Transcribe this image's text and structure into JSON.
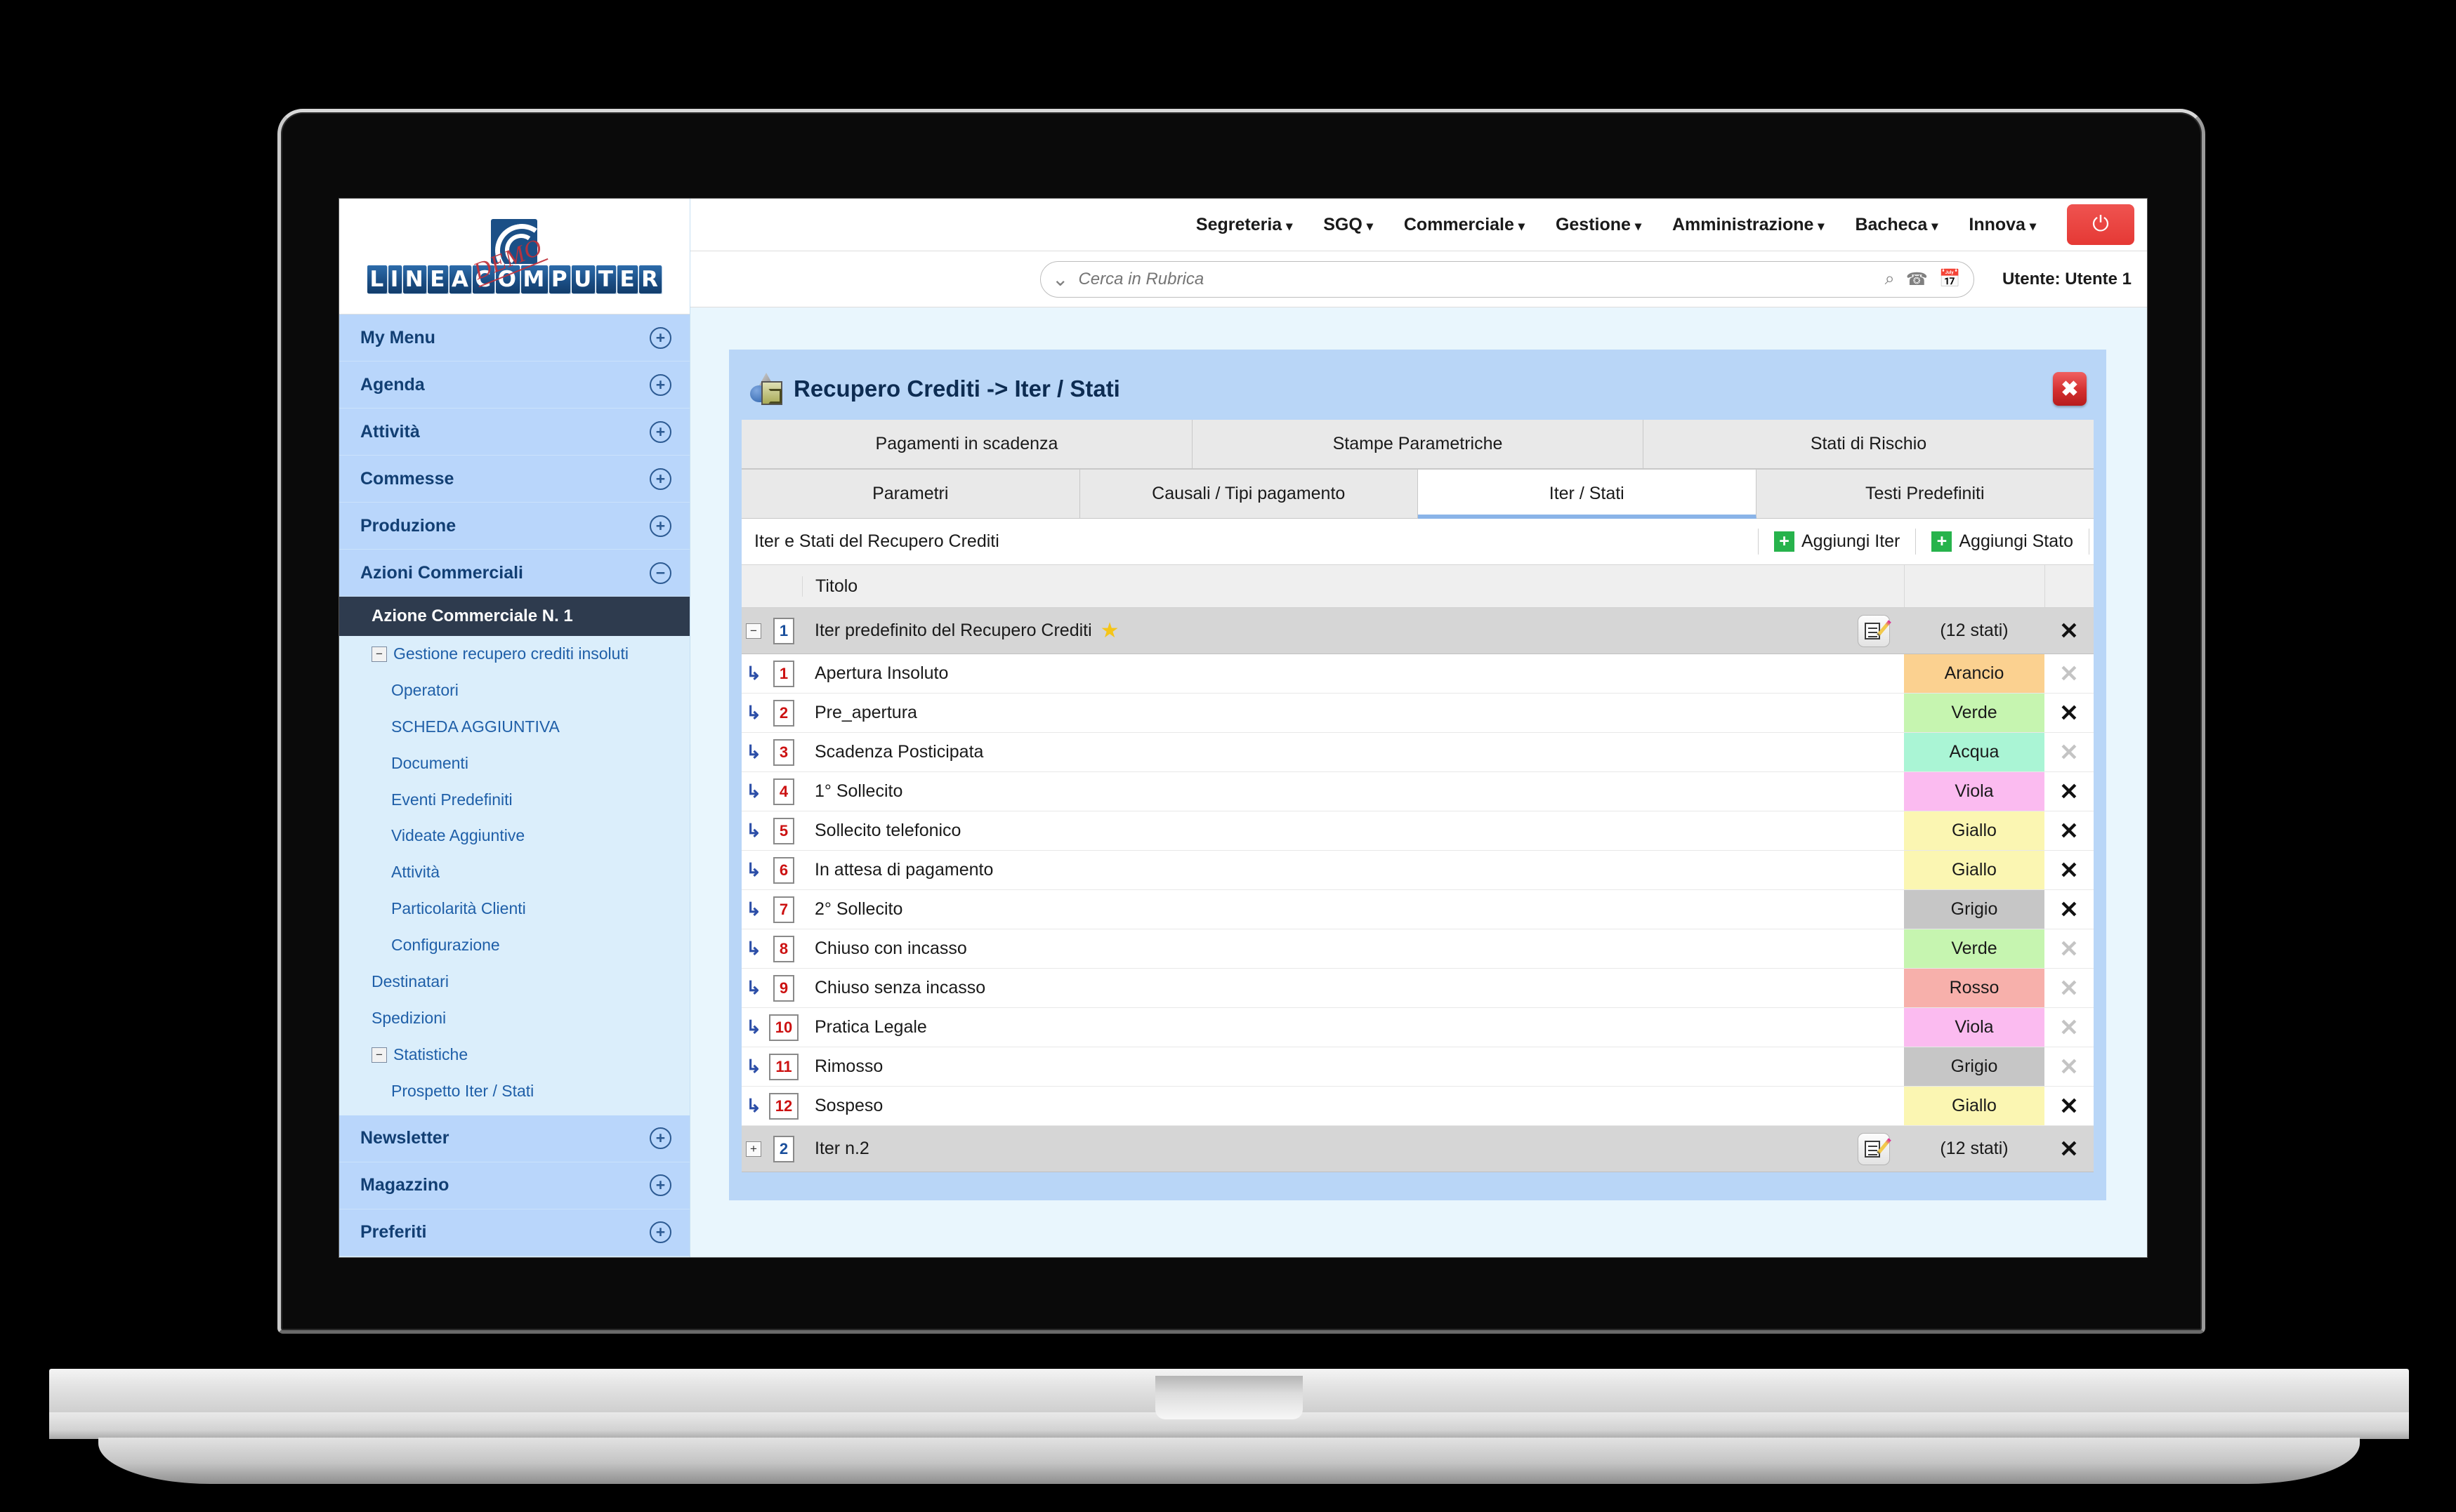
{
  "brand": {
    "logo_text": "LINEACOMPUTER",
    "logo_badge": "DEMO"
  },
  "topmenu": [
    {
      "label": "Segreteria"
    },
    {
      "label": "SGQ"
    },
    {
      "label": "Commerciale"
    },
    {
      "label": "Gestione"
    },
    {
      "label": "Amministrazione"
    },
    {
      "label": "Bacheca"
    },
    {
      "label": "Innova"
    }
  ],
  "power_icon": "⏻",
  "search": {
    "placeholder": "Cerca in Rubrica",
    "value": "",
    "chevron_icon": "⌄",
    "search_icon": "⌕",
    "phone_icon": "☎",
    "calendar_icon": "Ὄ5"
  },
  "user_label": "Utente: Utente 1",
  "sidebar": {
    "main_items": [
      {
        "label": "My Menu",
        "toggle": "+"
      },
      {
        "label": "Agenda",
        "toggle": "+"
      },
      {
        "label": "Attività",
        "toggle": "+"
      },
      {
        "label": "Commesse",
        "toggle": "+"
      },
      {
        "label": "Produzione",
        "toggle": "+"
      },
      {
        "label": "Azioni Commerciali",
        "toggle": "−"
      }
    ],
    "active_item": "Azione Commerciale N. 1",
    "sub_items": [
      {
        "label": "Gestione recupero crediti insoluti",
        "level": 1,
        "toggle": "−"
      },
      {
        "label": "Operatori",
        "level": 2,
        "toggle": ""
      },
      {
        "label": "SCHEDA AGGIUNTIVA",
        "level": 2,
        "toggle": ""
      },
      {
        "label": "Documenti",
        "level": 2,
        "toggle": ""
      },
      {
        "label": "Eventi Predefiniti",
        "level": 2,
        "toggle": ""
      },
      {
        "label": "Videate Aggiuntive",
        "level": 2,
        "toggle": ""
      },
      {
        "label": "Attività",
        "level": 2,
        "toggle": ""
      },
      {
        "label": "Particolarità Clienti",
        "level": 2,
        "toggle": ""
      },
      {
        "label": "Configurazione",
        "level": 2,
        "toggle": ""
      },
      {
        "label": "Destinatari",
        "level": 1,
        "toggle": ""
      },
      {
        "label": "Spedizioni",
        "level": 1,
        "toggle": ""
      },
      {
        "label": "Statistiche",
        "level": 1,
        "toggle": "−"
      },
      {
        "label": "Prospetto Iter / Stati",
        "level": 2,
        "toggle": ""
      }
    ],
    "bottom_items": [
      {
        "label": "Newsletter",
        "toggle": "+"
      },
      {
        "label": "Magazzino",
        "toggle": "+"
      },
      {
        "label": "Preferiti",
        "toggle": "+"
      }
    ]
  },
  "panel": {
    "title": "Recupero Crediti -> Iter / Stati",
    "close_label": "✖",
    "tabs_row1": [
      {
        "label": "Pagamenti in scadenza",
        "active": false
      },
      {
        "label": "Stampe Parametriche",
        "active": false
      },
      {
        "label": "Stati di Rischio",
        "active": false
      }
    ],
    "tabs_row2": [
      {
        "label": "Parametri",
        "active": false
      },
      {
        "label": "Causali / Tipi pagamento",
        "active": false
      },
      {
        "label": "Iter / Stati",
        "active": true
      },
      {
        "label": "Testi Predefiniti",
        "active": false
      }
    ],
    "subhead_label": "Iter e Stati del Recupero Crediti",
    "add_iter_label": "Aggiungi Iter",
    "add_stato_label": "Aggiungi Stato",
    "table": {
      "columns": {
        "titolo": "Titolo"
      },
      "rows": [
        {
          "kind": "iter",
          "expander": "−",
          "num": "1",
          "title": "Iter predefinito del Recupero Crediti",
          "starred": true,
          "count": "(12 stati)",
          "delete_enabled": true
        },
        {
          "kind": "state",
          "num": "1",
          "title": "Apertura Insoluto",
          "color_label": "Arancio",
          "color": "#fbd190",
          "delete_enabled": false
        },
        {
          "kind": "state",
          "num": "2",
          "title": "Pre_apertura",
          "color_label": "Verde",
          "color": "#c6f5b0",
          "delete_enabled": true
        },
        {
          "kind": "state",
          "num": "3",
          "title": "Scadenza Posticipata",
          "color_label": "Acqua",
          "color": "#aaf5d5",
          "delete_enabled": false
        },
        {
          "kind": "state",
          "num": "4",
          "title": "1° Sollecito",
          "color_label": "Viola",
          "color": "#fbbbf0",
          "delete_enabled": true
        },
        {
          "kind": "state",
          "num": "5",
          "title": "Sollecito telefonico",
          "color_label": "Giallo",
          "color": "#fbf6b2",
          "delete_enabled": true
        },
        {
          "kind": "state",
          "num": "6",
          "title": "In attesa di pagamento",
          "color_label": "Giallo",
          "color": "#fbf6b2",
          "delete_enabled": true
        },
        {
          "kind": "state",
          "num": "7",
          "title": "2° Sollecito",
          "color_label": "Grigio",
          "color": "#c6c6c6",
          "delete_enabled": true
        },
        {
          "kind": "state",
          "num": "8",
          "title": "Chiuso con incasso",
          "color_label": "Verde",
          "color": "#c6f5b0",
          "delete_enabled": false
        },
        {
          "kind": "state",
          "num": "9",
          "title": "Chiuso senza incasso",
          "color_label": "Rosso",
          "color": "#f7b0ab",
          "delete_enabled": false
        },
        {
          "kind": "state",
          "num": "10",
          "title": "Pratica Legale",
          "color_label": "Viola",
          "color": "#fbbbf0",
          "delete_enabled": false
        },
        {
          "kind": "state",
          "num": "11",
          "title": "Rimosso",
          "color_label": "Grigio",
          "color": "#c6c6c6",
          "delete_enabled": false
        },
        {
          "kind": "state",
          "num": "12",
          "title": "Sospeso",
          "color_label": "Giallo",
          "color": "#fbf6b2",
          "delete_enabled": true
        },
        {
          "kind": "iter",
          "expander": "+",
          "num": "2",
          "title": "Iter n.2",
          "starred": false,
          "count": "(12 stati)",
          "delete_enabled": true
        }
      ]
    }
  },
  "colors": {
    "accent_blue": "#b9d6f7",
    "page_bg": "#e9f6fd",
    "sidebar_main": "#b9d6fb",
    "sidebar_sub": "#dbeefb",
    "active_nav": "#2e3b4e",
    "danger_red": "#d32f2f",
    "add_green": "#27b34c"
  }
}
